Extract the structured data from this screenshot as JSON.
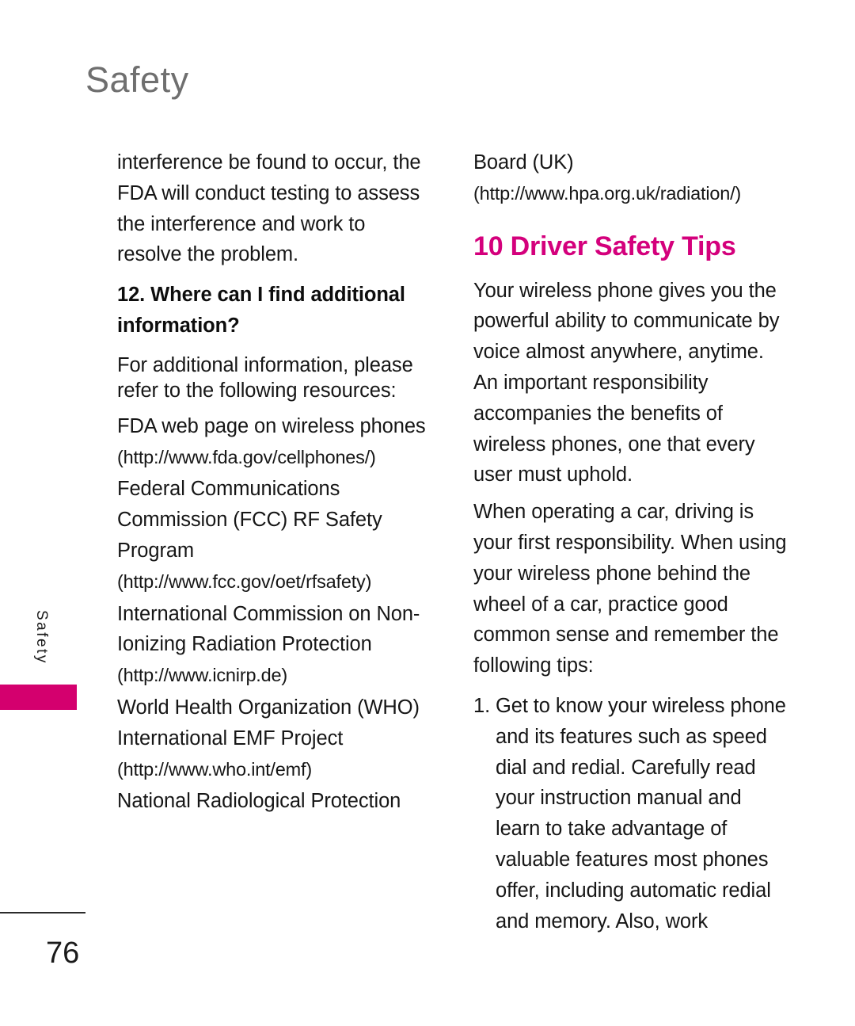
{
  "header": {
    "title": "Safety"
  },
  "side_tab": {
    "label": "Safety"
  },
  "footer": {
    "page_number": "76"
  },
  "colors": {
    "accent_pink": "#d4007c",
    "tab_pink": "#d4006e",
    "header_gray": "#6f6f6f",
    "body_black": "#161616"
  },
  "left_column": {
    "continued_paragraph": "interference be found to occur, the FDA will conduct testing to assess the interference and work to resolve the problem.",
    "faq_heading": "12. Where can I find additional information?",
    "intro": "For additional information, please refer to the following resources:",
    "resources": [
      {
        "name": "FDA web page on wireless phones",
        "url": "(http://www.fda.gov/cellphones/)"
      },
      {
        "name": "Federal Communications Commission (FCC) RF Safety Program",
        "url": "(http://www.fcc.gov/oet/rfsafety)"
      },
      {
        "name": "International Commission on Non-Ionizing Radiation Protection",
        "url": "(http://www.icnirp.de)"
      },
      {
        "name": "World Health Organization (WHO) International EMF Project",
        "url": "(http://www.who.int/emf)"
      }
    ],
    "last_resource_partial": "National Radiological Protection"
  },
  "right_column": {
    "continued_name": "Board (UK)",
    "continued_url": "(http://www.hpa.org.uk/radiation/)",
    "section_title": "10 Driver Safety Tips",
    "paragraph_1": "Your wireless phone gives you the powerful ability to communicate by voice almost anywhere, anytime. An important responsibility accompanies the benefits of wireless phones, one that every user must uphold.",
    "paragraph_2": "When operating a car, driving is your first responsibility. When using your wireless phone behind the wheel of a car, practice good common sense and remember the following tips:",
    "list": [
      {
        "marker": "1.",
        "text": "Get to know your wireless phone and its features such as speed dial and redial. Carefully read your instruction manual and learn to take advantage of valuable features most phones offer, including automatic redial and memory. Also, work"
      }
    ]
  }
}
